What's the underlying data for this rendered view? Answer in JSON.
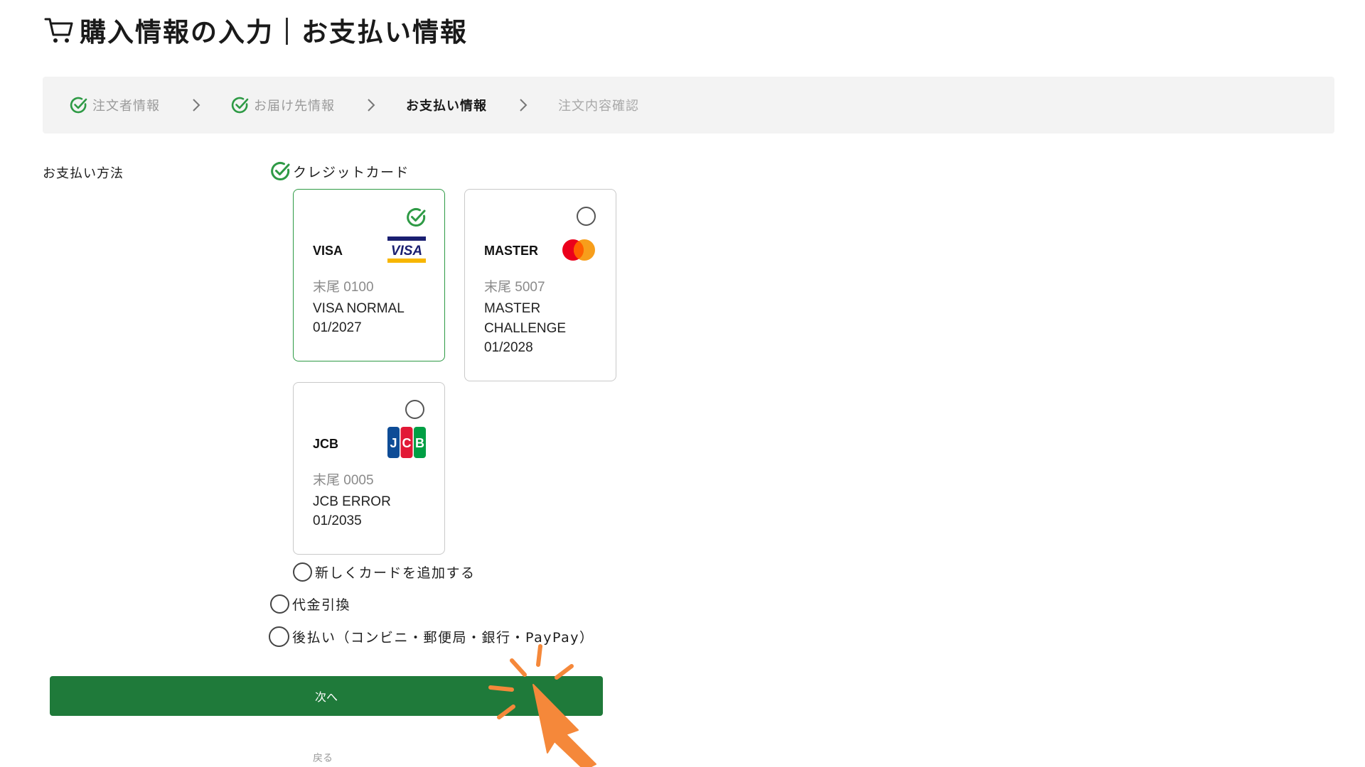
{
  "header": {
    "title": "購入情報の入力｜お支払い情報",
    "icon": "cart-icon"
  },
  "stepper": {
    "steps": [
      {
        "label": "注文者情報",
        "state": "done"
      },
      {
        "label": "お届け先情報",
        "state": "done"
      },
      {
        "label": "お支払い情報",
        "state": "active"
      },
      {
        "label": "注文内容確認",
        "state": "todo"
      }
    ]
  },
  "payment": {
    "section_label": "お支払い方法",
    "credit_card_label": "クレジットカード",
    "cards": [
      {
        "brand": "VISA",
        "tail": "末尾 0100",
        "holder": "VISA NORMAL",
        "expiry": "01/2027",
        "selected": true
      },
      {
        "brand": "MASTER",
        "tail": "末尾 5007",
        "holder": "MASTER CHALLENGE",
        "expiry": "01/2028",
        "selected": false
      },
      {
        "brand": "JCB",
        "tail": "末尾 0005",
        "holder": "JCB ERROR",
        "expiry": "01/2035",
        "selected": false
      }
    ],
    "add_card_label": "新しくカードを追加する",
    "cod_label": "代金引換",
    "deferred_label": "後払い（コンビニ・郵便局・銀行・PayPay）"
  },
  "actions": {
    "next_label": "次へ",
    "back_label": "戻る"
  },
  "colors": {
    "accent_green": "#2e9a45",
    "button_green": "#1f7a3a",
    "stepper_bg": "#f3f3f3",
    "cursor_orange": "#f5883a"
  }
}
